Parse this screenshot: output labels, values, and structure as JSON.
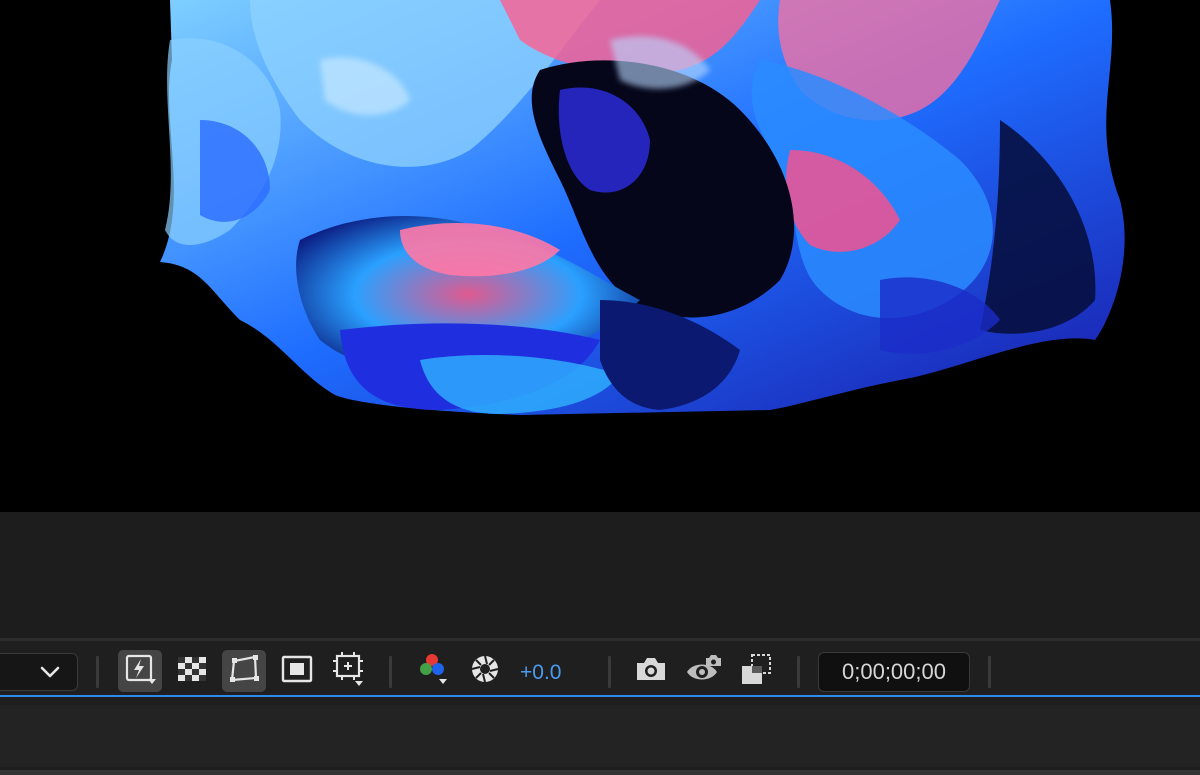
{
  "toolbar": {
    "magnification_dropdown": {
      "icon": "chevron-down-icon"
    },
    "buttons": [
      {
        "name": "fast-previews",
        "icon": "fast-previews-icon",
        "active": true
      },
      {
        "name": "transparency-grid",
        "icon": "checkerboard-icon",
        "active": false
      },
      {
        "name": "mask-path-visibility",
        "icon": "mask-shape-icon",
        "active": true
      },
      {
        "name": "region-of-interest",
        "icon": "region-of-interest-icon",
        "active": false
      },
      {
        "name": "grid-guides",
        "icon": "grid-guide-icon",
        "active": false
      },
      {
        "name": "show-channel",
        "icon": "rgb-channels-icon",
        "active": false
      },
      {
        "name": "reset-exposure",
        "icon": "aperture-icon",
        "active": false
      },
      {
        "name": "snapshot",
        "icon": "camera-icon",
        "active": false
      },
      {
        "name": "show-snapshot",
        "icon": "eye-snapshot-icon",
        "active": false
      },
      {
        "name": "toggle-transparency-overlay",
        "icon": "overlay-toggle-icon",
        "active": false
      }
    ],
    "exposure_value": "+0.0",
    "timecode": "0;00;00;00"
  },
  "colors": {
    "accent": "#2d8ceb",
    "exposure_text": "#4a9bf0",
    "panel_bg": "#1d1d1d",
    "viewer_bg": "#000000"
  }
}
